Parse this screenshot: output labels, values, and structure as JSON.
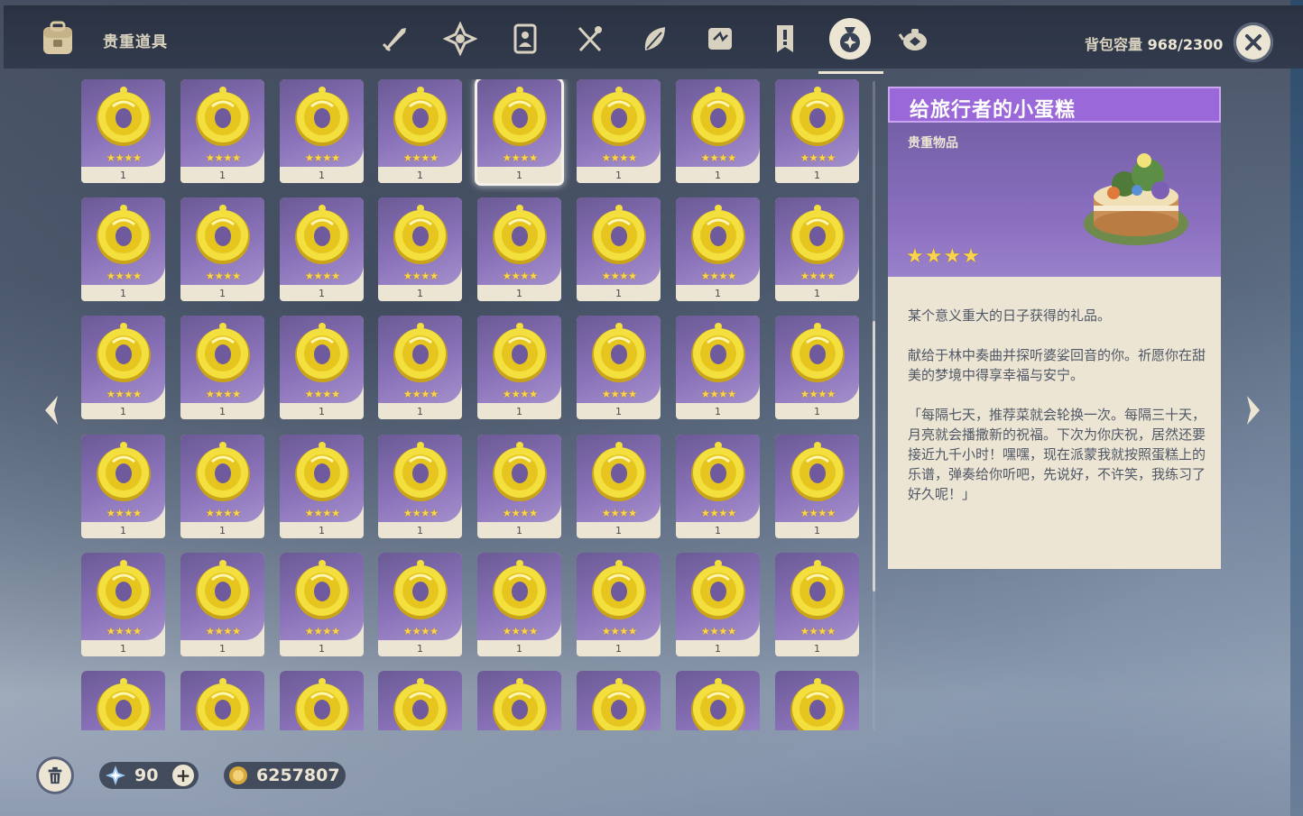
{
  "header": {
    "section_title": "贵重道具",
    "tabs": [
      {
        "name": "weapon",
        "icon": "sword-icon"
      },
      {
        "name": "artifact",
        "icon": "artifact-flower-icon"
      },
      {
        "name": "character-development",
        "icon": "ascension-material-icon"
      },
      {
        "name": "food",
        "icon": "fork-spoon-icon"
      },
      {
        "name": "materials",
        "icon": "leaf-material-icon"
      },
      {
        "name": "gadget",
        "icon": "gadget-icon"
      },
      {
        "name": "quest",
        "icon": "quest-icon"
      },
      {
        "name": "precious",
        "icon": "precious-bag-icon",
        "active": true
      },
      {
        "name": "furnishing",
        "icon": "teapot-icon"
      }
    ],
    "capacity_label": "背包容量",
    "capacity_value": "968/2300"
  },
  "grid": {
    "columns": 8,
    "rows": 6,
    "item_name": "给旅行者的小蛋糕",
    "item_rarity": 4,
    "stars_text": "★★★★",
    "count": "1",
    "selected_index": 4
  },
  "detail": {
    "title": "给旅行者的小蛋糕",
    "category": "贵重物品",
    "rarity": 4,
    "stars_text": "★★★★",
    "desc1": "某个意义重大的日子获得的礼品。",
    "desc2": "献给于林中奏曲并探听婆娑回音的你。祈愿你在甜美的梦境中得享幸福与安宁。",
    "desc3": "「每隔七天，推荐菜就会轮换一次。每隔三十天，月亮就会播撒新的祝福。下次为你庆祝，居然还要接近九千小时！嘿嘿，现在派蒙我就按照蛋糕上的乐谱，弹奏给你听吧，先说好，不许笑，我练习了好久呢！」"
  },
  "footer": {
    "primogem_value": "90",
    "mora_value": "6257807"
  },
  "colors": {
    "card_purple": "#8a72b9",
    "title_purple": "#9b68d9",
    "cream": "#ece5d3",
    "star_gold": "#f9d44c"
  }
}
